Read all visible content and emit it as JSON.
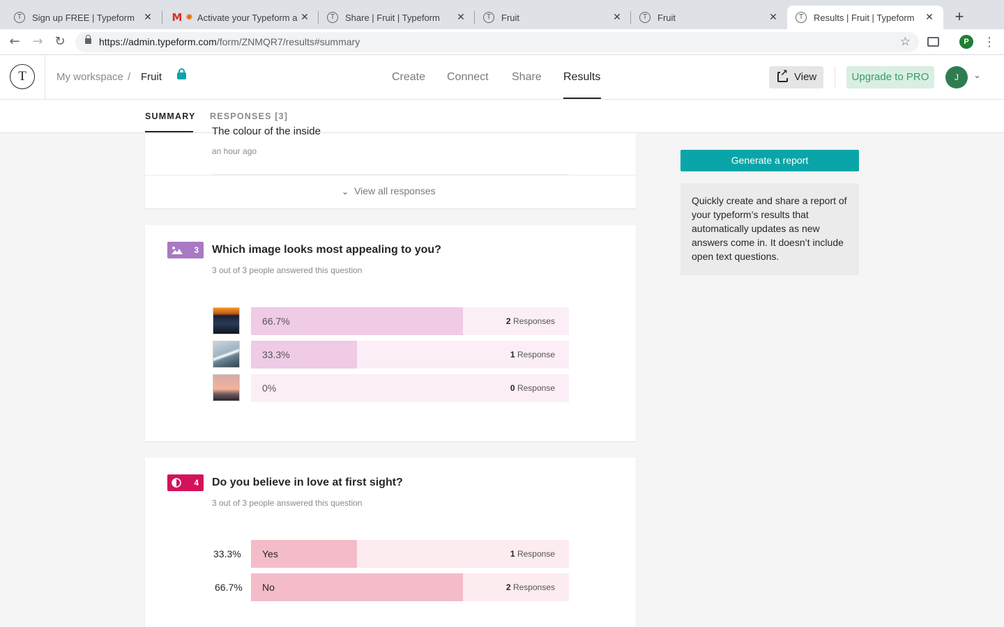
{
  "browser": {
    "tabs": [
      {
        "title": "Sign up FREE | Typeform",
        "favicon": "typeform-icon"
      },
      {
        "title": "Activate your Typeform a",
        "favicon": "gmail-icon"
      },
      {
        "title": "Share | Fruit | Typeform",
        "favicon": "typeform-icon"
      },
      {
        "title": "Fruit",
        "favicon": "typeform-icon"
      },
      {
        "title": "Fruit",
        "favicon": "typeform-icon"
      },
      {
        "title": "Results | Fruit | Typeform",
        "favicon": "typeform-icon",
        "active": true
      }
    ],
    "url_host": "https://admin.typeform.com",
    "url_path": "/form/ZNMQR7/results#summary",
    "profile_initial": "P"
  },
  "header": {
    "logo_letter": "T",
    "breadcrumb": [
      "My workspace",
      "/",
      "Fruit"
    ],
    "nav": [
      "Create",
      "Connect",
      "Share",
      "Results"
    ],
    "active_nav": "Results",
    "view_label": "View",
    "upgrade_label": "Upgrade to PRO",
    "avatar_initial": "J"
  },
  "subtabs": {
    "summary": "SUMMARY",
    "responses": "RESPONSES [3]"
  },
  "previous": {
    "clipped_text": "The colour of the inside",
    "time": "an hour ago",
    "view_all": "View all responses"
  },
  "q3": {
    "number": "3",
    "title": "Which image looks most appealing to you?",
    "subtitle": "3 out of 3 people answered this question",
    "options": [
      {
        "pct": "66.7%",
        "count": "2",
        "label": "Responses",
        "fraction": 0.667
      },
      {
        "pct": "33.3%",
        "count": "1",
        "label": "Response",
        "fraction": 0.333
      },
      {
        "pct": "0%",
        "count": "0",
        "label": "Response",
        "fraction": 0
      }
    ]
  },
  "q4": {
    "number": "4",
    "title": "Do you believe in love at first sight?",
    "subtitle": "3 out of 3 people answered this question",
    "options": [
      {
        "pct": "33.3%",
        "answer": "Yes",
        "count": "1",
        "label": "Response",
        "fraction": 0.333
      },
      {
        "pct": "66.7%",
        "answer": "No",
        "count": "2",
        "label": "Responses",
        "fraction": 0.667
      }
    ]
  },
  "sidebar": {
    "generate_label": "Generate a report",
    "info_text": "Quickly create and share a report of your typeform’s results that automatically updates as new answers come in. It doesn’t include open text questions."
  },
  "colors": {
    "accent": "#0aa5a9",
    "picture_choice": "#a77ac3",
    "yes_no": "#d5115b",
    "image_bar_fill": "#efcbe6",
    "image_bar_bg": "#fbeef7",
    "yesno_bar_fill": "#f4bcc9",
    "yesno_bar_bg": "#fcebef"
  }
}
